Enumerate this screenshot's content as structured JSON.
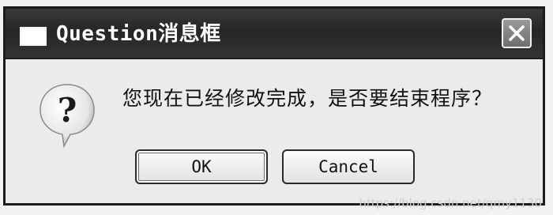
{
  "window": {
    "title": "Question消息框",
    "icon": "window-icon",
    "close_icon": "close-icon"
  },
  "dialog": {
    "icon": "question-icon",
    "icon_glyph": "?",
    "message": "您现在已经修改完成，是否要结束程序？"
  },
  "buttons": {
    "ok_label": "OK",
    "cancel_label": "Cancel"
  },
  "watermark": "https://blog.csdn.net/qmy1130",
  "colors": {
    "titlebar": "#2b2b2b",
    "dialog_bg": "#ebebeb",
    "button_border": "#2a2a2a"
  }
}
